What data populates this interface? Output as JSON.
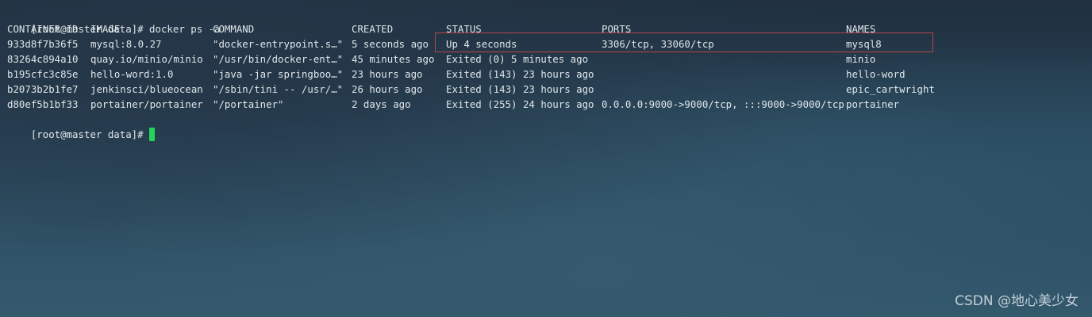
{
  "terminal": {
    "command_line": "[root@master data]# docker ps -a",
    "prompt": "[root@master data]# ",
    "headers": {
      "id": "CONTAINER ID",
      "image": "IMAGE",
      "command": "COMMAND",
      "created": "CREATED",
      "status": "STATUS",
      "ports": "PORTS",
      "names": "NAMES"
    },
    "rows": [
      {
        "id": "933d8f7b36f5",
        "image": "mysql:8.0.27",
        "command": "\"docker-entrypoint.s…\"",
        "created": "5 seconds ago",
        "status": "Up 4 seconds",
        "ports": "3306/tcp, 33060/tcp",
        "names": "mysql8"
      },
      {
        "id": "83264c894a10",
        "image": "quay.io/minio/minio",
        "command": "\"/usr/bin/docker-ent…\"",
        "created": "45 minutes ago",
        "status": "Exited (0) 5 minutes ago",
        "ports": "",
        "names": "minio"
      },
      {
        "id": "b195cfc3c85e",
        "image": "hello-word:1.0",
        "command": "\"java -jar springboo…\"",
        "created": "23 hours ago",
        "status": "Exited (143) 23 hours ago",
        "ports": "",
        "names": "hello-word"
      },
      {
        "id": "b2073b2b1fe7",
        "image": "jenkinsci/blueocean",
        "command": "\"/sbin/tini -- /usr/…\"",
        "created": "26 hours ago",
        "status": "Exited (143) 23 hours ago",
        "ports": "",
        "names": "epic_cartwright"
      },
      {
        "id": "d80ef5b1bf33",
        "image": "portainer/portainer",
        "command": "\"/portainer\"",
        "created": "2 days ago",
        "status": "Exited (255) 24 hours ago",
        "ports": "0.0.0.0:9000->9000/tcp, :::9000->9000/tcp",
        "names": "portainer"
      }
    ]
  },
  "watermark": "CSDN @地心美少女",
  "colors": {
    "text": "#dfe6ea",
    "cursor": "#22d45c",
    "highlight_border": "#b8424a"
  }
}
